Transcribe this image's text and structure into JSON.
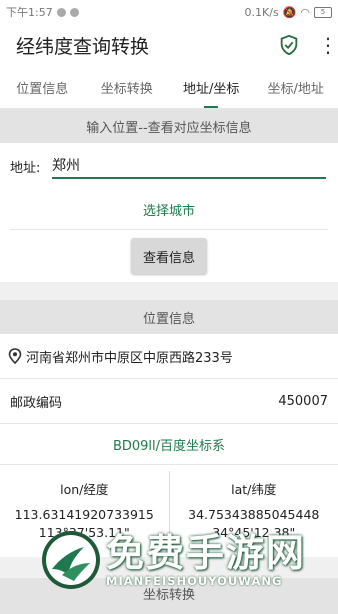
{
  "status_bar": {
    "time": "下午1:57",
    "speed": "0.1K/s",
    "battery": "5"
  },
  "app_bar": {
    "title": "经纬度查询转换",
    "shield_icon": "shield-check-icon",
    "more_icon": "more-vertical-icon"
  },
  "tabs": [
    {
      "label": "位置信息"
    },
    {
      "label": "坐标转换"
    },
    {
      "label": "地址/坐标",
      "active": true
    },
    {
      "label": "坐标/地址"
    }
  ],
  "input_section": {
    "header": "输入位置--查看对应坐标信息",
    "address_label": "地址:",
    "address_value": "郑州",
    "select_city": "选择城市",
    "query_button": "查看信息"
  },
  "info_section": {
    "header": "位置信息",
    "location": "河南省郑州市中原区中原西路233号",
    "postal_label": "邮政编码",
    "postal_value": "450007",
    "coord_system": "BD09ll/百度坐标系",
    "lon_label": "lon/经度",
    "lon_value": "113.63141920733915",
    "lon_dms": "113°37'53.11\"",
    "lat_label": "lat/纬度",
    "lat_value": "34.75343885045448",
    "lat_dms": "34°45'12.38\""
  },
  "bottom_section": {
    "header": "坐标转换"
  },
  "watermark": {
    "title": "免费手游网",
    "subtitle": "MIANFEISHOUYOUWANG"
  },
  "colors": {
    "accent": "#1e7a4e",
    "section_bg": "#e3e3e3",
    "page_bg": "#f0f0f0"
  }
}
